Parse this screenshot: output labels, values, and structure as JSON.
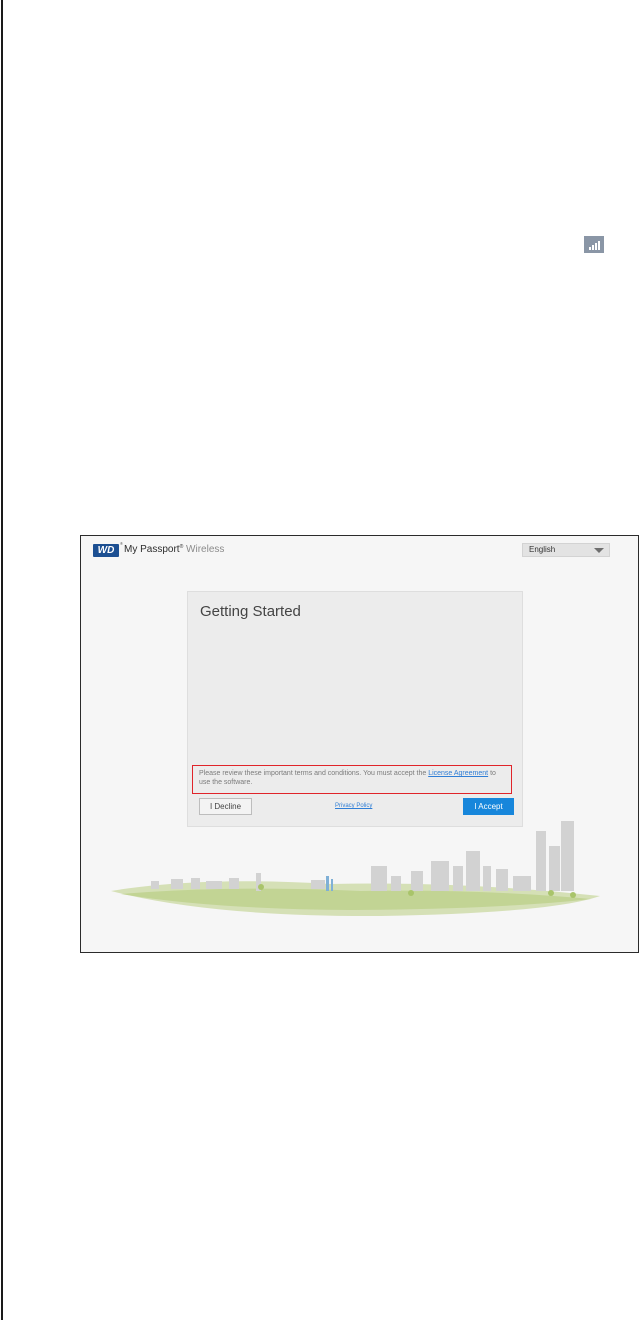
{
  "app": {
    "logo_text": "WD",
    "logo_reg": "®",
    "product_name": "My Passport",
    "product_reg": "®",
    "product_suffix": "Wireless"
  },
  "language": {
    "selected": "English"
  },
  "dialog": {
    "title": "Getting Started",
    "terms_text_before": "Please review these important terms and conditions. You must accept the ",
    "terms_link": "License Agreement",
    "terms_text_after": " to use the software.",
    "decline_label": "I Decline",
    "privacy_label": "Privacy Policy",
    "accept_label": "I Accept"
  },
  "colors": {
    "accent": "#1786db",
    "highlight_border": "#e0242a",
    "wd_blue": "#1c4f92",
    "link": "#2f7ed6"
  },
  "icons": {
    "signal": "signal-strength-icon",
    "dropdown": "chevron-down-icon"
  }
}
